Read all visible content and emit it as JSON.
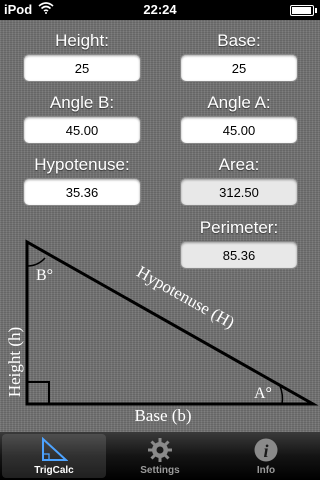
{
  "status_bar": {
    "carrier": "iPod",
    "time": "22:24"
  },
  "form": {
    "height": {
      "label": "Height:",
      "value": "25"
    },
    "base": {
      "label": "Base:",
      "value": "25"
    },
    "angle_b": {
      "label": "Angle B:",
      "value": "45.00"
    },
    "angle_a": {
      "label": "Angle A:",
      "value": "45.00"
    },
    "hypotenuse": {
      "label": "Hypotenuse:",
      "value": "35.36"
    },
    "area": {
      "label": "Area:",
      "value": "312.50"
    },
    "perimeter": {
      "label": "Perimeter:",
      "value": "85.36"
    }
  },
  "diagram": {
    "angle_b_label": "B°",
    "angle_a_label": "A°",
    "height_label": "Height (h)",
    "base_label": "Base (b)",
    "hypotenuse_label": "Hypotenuse (H)"
  },
  "tab_bar": {
    "tabs": [
      {
        "label": "TrigCalc",
        "icon": "triangle-icon",
        "active": true
      },
      {
        "label": "Settings",
        "icon": "gear-icon",
        "active": false
      },
      {
        "label": "Info",
        "icon": "info-icon",
        "active": false
      }
    ]
  },
  "colors": {
    "background": "#727272",
    "tab_accent": "#4da3ff"
  }
}
